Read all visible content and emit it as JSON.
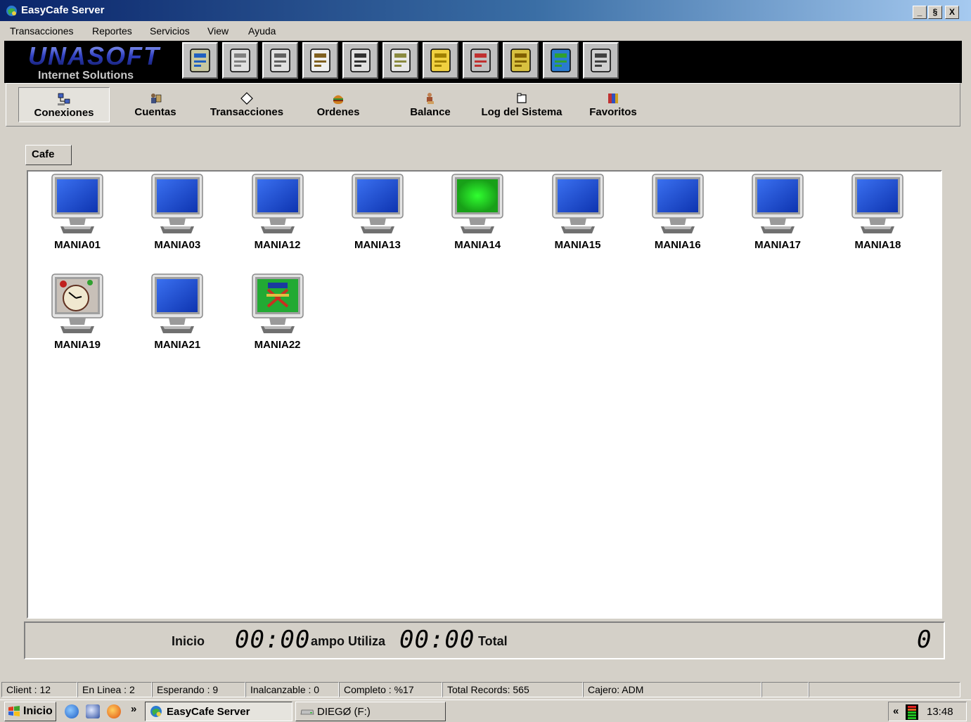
{
  "window": {
    "title": "EasyCafe Server",
    "minimize_label": "_",
    "maximize_label": "§",
    "close_label": "X"
  },
  "menu": [
    "Transacciones",
    "Reportes",
    "Servicios",
    "View",
    "Ayuda"
  ],
  "logo": {
    "brand": "UNASOFT",
    "tagline": "Internet Solutions"
  },
  "toolbar_icons": [
    "calculator-icon",
    "documents-icon",
    "clipboard-icon",
    "gears-icon",
    "keypad-icon",
    "keys-icon",
    "key-icon",
    "user-door-icon",
    "door-icon",
    "globe-icon",
    "pen-paper-icon"
  ],
  "nav": [
    {
      "label": "Conexiones",
      "icon": "network-icon",
      "active": true
    },
    {
      "label": "Cuentas",
      "icon": "accounts-icon",
      "active": false
    },
    {
      "label": "Transacciones",
      "icon": "diamond-icon",
      "active": false
    },
    {
      "label": "Ordenes",
      "icon": "burger-icon",
      "active": false
    },
    {
      "label": "Balance",
      "icon": "balance-icon",
      "active": false
    },
    {
      "label": "Log del Sistema",
      "icon": "log-icon",
      "active": false
    },
    {
      "label": "Favoritos",
      "icon": "favorites-icon",
      "active": false
    }
  ],
  "tab": {
    "label": "Cafe"
  },
  "clients": [
    {
      "name": "MANIA01",
      "state": "waiting",
      "screen_color": "#1d4fd1"
    },
    {
      "name": "MANIA03",
      "state": "waiting",
      "screen_color": "#1d4fd1"
    },
    {
      "name": "MANIA12",
      "state": "waiting",
      "screen_color": "#1d4fd1"
    },
    {
      "name": "MANIA13",
      "state": "waiting",
      "screen_color": "#1d4fd1"
    },
    {
      "name": "MANIA14",
      "state": "online",
      "screen_color": "#22bb22"
    },
    {
      "name": "MANIA15",
      "state": "waiting",
      "screen_color": "#1d4fd1"
    },
    {
      "name": "MANIA16",
      "state": "waiting",
      "screen_color": "#1d4fd1"
    },
    {
      "name": "MANIA17",
      "state": "waiting",
      "screen_color": "#1d4fd1"
    },
    {
      "name": "MANIA18",
      "state": "waiting",
      "screen_color": "#1d4fd1"
    },
    {
      "name": "MANIA19",
      "state": "clock",
      "screen_color": "#b0a8a0"
    },
    {
      "name": "MANIA21",
      "state": "waiting",
      "screen_color": "#1d4fd1"
    },
    {
      "name": "MANIA22",
      "state": "director-chair",
      "screen_color": "#22aa33"
    }
  ],
  "timer": {
    "inicio_label": "Inicio",
    "inicio_value": "00:00",
    "tiempo_label": "ampo Utiliza",
    "tiempo_value": "00:00",
    "total_label": "Total",
    "total_value": "0"
  },
  "status": [
    "Client : 12",
    "En Linea : 2",
    "Esperando : 9",
    "Inalcanzable : 0",
    "Completo : %17",
    "Total Records: 565",
    "Cajero: ADM",
    "",
    ""
  ],
  "taskbar": {
    "start_label": "Inicio",
    "chevron": "»",
    "tasks": [
      {
        "label": "EasyCafe Server",
        "active": true
      },
      {
        "label": "DIEGØ (F:)",
        "active": false
      }
    ],
    "tray_chevron": "«",
    "time": "13:48"
  },
  "colors": {
    "titlebar_start": "#0a246a",
    "titlebar_end": "#a6caf0",
    "monitor_waiting": "#1d4fd1",
    "monitor_online": "#22bb22"
  }
}
